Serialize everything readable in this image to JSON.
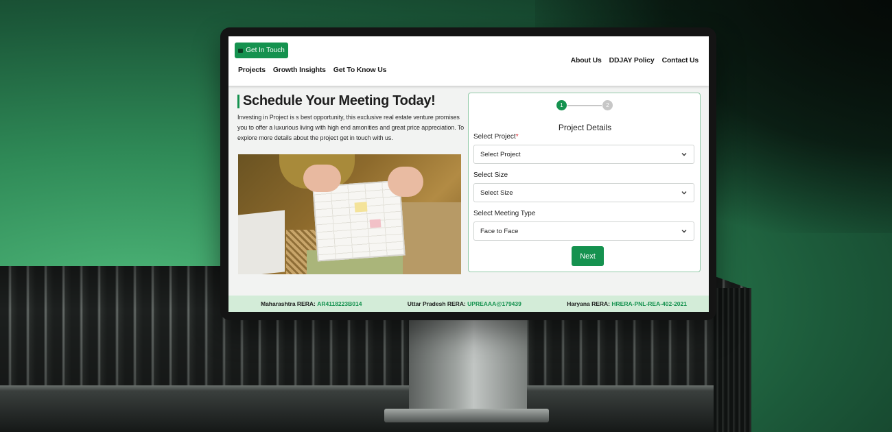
{
  "header": {
    "cta_label": "Get In Touch",
    "nav_left": [
      "Projects",
      "Growth Insights",
      "Get To Know Us"
    ],
    "nav_right": [
      "About Us",
      "DDJAY Policy",
      "Contact Us"
    ]
  },
  "hero": {
    "title": "Schedule Your Meeting Today!",
    "intro": "Investing in Project is s best opportunity, this exclusive real estate venture promises you to offer a luxurious living with high end amonities and great price appreciation. To explore more details about the project get in touch with us."
  },
  "form": {
    "steps": [
      "1",
      "2"
    ],
    "current_step": 1,
    "title": "Project Details",
    "project_label": "Select Project",
    "project_required": "*",
    "project_value": "Select Project",
    "size_label": "Select Size",
    "size_value": "Select Size",
    "meeting_label": "Select Meeting Type",
    "meeting_value": "Face to Face",
    "next_label": "Next"
  },
  "footer": {
    "rera": [
      {
        "label": "Maharashtra RERA:",
        "value": "AR4118223B014"
      },
      {
        "label": "Uttar Pradesh RERA:",
        "value": "UPREAAA@179439"
      },
      {
        "label": "Haryana RERA:",
        "value": "HRERA-PNL-REA-402-2021"
      }
    ]
  },
  "colors": {
    "brand_green": "#15924f",
    "footer_bg": "#d3ecd8",
    "required_red": "#d9232d"
  }
}
